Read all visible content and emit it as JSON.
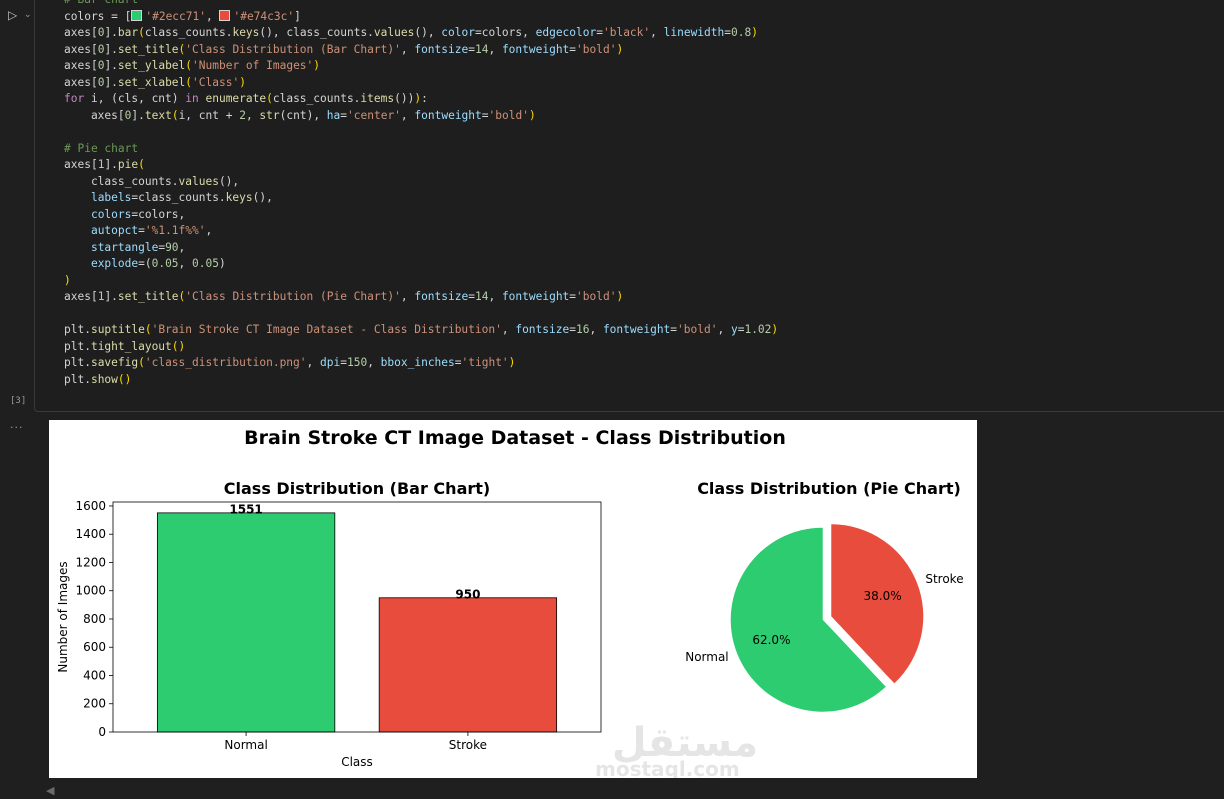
{
  "cell": {
    "execution_count": "[3]",
    "output_marker": "...",
    "code_lines": [
      [
        [
          "c-com",
          "# Bar chart"
        ]
      ],
      [
        [
          "",
          "colors = ["
        ],
        [
          "sw:#2ecc71",
          ""
        ],
        [
          "c-str",
          "'#2ecc71'"
        ],
        [
          "",
          ", "
        ],
        [
          "sw:#e74c3c",
          ""
        ],
        [
          "c-str",
          "'#e74c3c'"
        ],
        [
          "",
          "]"
        ]
      ],
      [
        [
          "",
          "axes["
        ],
        [
          "c-num",
          "0"
        ],
        [
          "",
          "]."
        ],
        [
          "c-fn",
          "bar"
        ],
        [
          "c-par",
          "("
        ],
        [
          "",
          "class_counts."
        ],
        [
          "c-fn",
          "keys"
        ],
        [
          "",
          "(), class_counts."
        ],
        [
          "c-fn",
          "values"
        ],
        [
          "",
          "(), "
        ],
        [
          "c-var",
          "color"
        ],
        [
          "",
          "=colors, "
        ],
        [
          "c-var",
          "edgecolor"
        ],
        [
          "",
          "="
        ],
        [
          "c-str",
          "'black'"
        ],
        [
          "",
          ", "
        ],
        [
          "c-var",
          "linewidth"
        ],
        [
          "",
          "="
        ],
        [
          "c-num",
          "0.8"
        ],
        [
          "c-par",
          ")"
        ]
      ],
      [
        [
          "",
          "axes["
        ],
        [
          "c-num",
          "0"
        ],
        [
          "",
          "]."
        ],
        [
          "c-fn",
          "set_title"
        ],
        [
          "c-par",
          "("
        ],
        [
          "c-str",
          "'Class Distribution (Bar Chart)'"
        ],
        [
          "",
          ", "
        ],
        [
          "c-var",
          "fontsize"
        ],
        [
          "",
          "="
        ],
        [
          "c-num",
          "14"
        ],
        [
          "",
          ", "
        ],
        [
          "c-var",
          "fontweight"
        ],
        [
          "",
          "="
        ],
        [
          "c-str",
          "'bold'"
        ],
        [
          "c-par",
          ")"
        ]
      ],
      [
        [
          "",
          "axes["
        ],
        [
          "c-num",
          "0"
        ],
        [
          "",
          "]."
        ],
        [
          "c-fn",
          "set_ylabel"
        ],
        [
          "c-par",
          "("
        ],
        [
          "c-str",
          "'Number of Images'"
        ],
        [
          "c-par",
          ")"
        ]
      ],
      [
        [
          "",
          "axes["
        ],
        [
          "c-num",
          "0"
        ],
        [
          "",
          "]."
        ],
        [
          "c-fn",
          "set_xlabel"
        ],
        [
          "c-par",
          "("
        ],
        [
          "c-str",
          "'Class'"
        ],
        [
          "c-par",
          ")"
        ]
      ],
      [
        [
          "c-kw",
          "for"
        ],
        [
          "",
          " i, (cls, cnt) "
        ],
        [
          "c-kw",
          "in"
        ],
        [
          "c-fn",
          " enumerate"
        ],
        [
          "c-par",
          "("
        ],
        [
          "",
          "class_counts."
        ],
        [
          "c-fn",
          "items"
        ],
        [
          "",
          "())"
        ],
        [
          "c-par",
          ")"
        ],
        [
          "",
          ":"
        ]
      ],
      [
        [
          "",
          "    axes["
        ],
        [
          "c-num",
          "0"
        ],
        [
          "",
          "]."
        ],
        [
          "c-fn",
          "text"
        ],
        [
          "c-par",
          "("
        ],
        [
          "",
          "i, cnt + "
        ],
        [
          "c-num",
          "2"
        ],
        [
          "",
          ", "
        ],
        [
          "c-fn",
          "str"
        ],
        [
          "",
          "(cnt), "
        ],
        [
          "c-var",
          "ha"
        ],
        [
          "",
          "="
        ],
        [
          "c-str",
          "'center'"
        ],
        [
          "",
          ", "
        ],
        [
          "c-var",
          "fontweight"
        ],
        [
          "",
          "="
        ],
        [
          "c-str",
          "'bold'"
        ],
        [
          "c-par",
          ")"
        ]
      ],
      [
        [
          "",
          ""
        ]
      ],
      [
        [
          "c-com",
          "# Pie chart"
        ]
      ],
      [
        [
          "",
          "axes["
        ],
        [
          "c-num",
          "1"
        ],
        [
          "",
          "]."
        ],
        [
          "c-fn",
          "pie"
        ],
        [
          "c-par",
          "("
        ]
      ],
      [
        [
          "",
          "    class_counts."
        ],
        [
          "c-fn",
          "values"
        ],
        [
          "",
          "(),"
        ]
      ],
      [
        [
          "",
          "    "
        ],
        [
          "c-var",
          "labels"
        ],
        [
          "",
          "=class_counts."
        ],
        [
          "c-fn",
          "keys"
        ],
        [
          "",
          "(),"
        ]
      ],
      [
        [
          "",
          "    "
        ],
        [
          "c-var",
          "colors"
        ],
        [
          "",
          "=colors,"
        ]
      ],
      [
        [
          "",
          "    "
        ],
        [
          "c-var",
          "autopct"
        ],
        [
          "",
          "="
        ],
        [
          "c-str",
          "'%1.1f%%'"
        ],
        [
          "",
          ","
        ]
      ],
      [
        [
          "",
          "    "
        ],
        [
          "c-var",
          "startangle"
        ],
        [
          "",
          "="
        ],
        [
          "c-num",
          "90"
        ],
        [
          "",
          ","
        ]
      ],
      [
        [
          "",
          "    "
        ],
        [
          "c-var",
          "explode"
        ],
        [
          "",
          "=("
        ],
        [
          "c-num",
          "0.05"
        ],
        [
          "",
          ", "
        ],
        [
          "c-num",
          "0.05"
        ],
        [
          "",
          ")"
        ]
      ],
      [
        [
          "c-par",
          ")"
        ]
      ],
      [
        [
          "",
          "axes["
        ],
        [
          "c-num",
          "1"
        ],
        [
          "",
          "]."
        ],
        [
          "c-fn",
          "set_title"
        ],
        [
          "c-par",
          "("
        ],
        [
          "c-str",
          "'Class Distribution (Pie Chart)'"
        ],
        [
          "",
          ", "
        ],
        [
          "c-var",
          "fontsize"
        ],
        [
          "",
          "="
        ],
        [
          "c-num",
          "14"
        ],
        [
          "",
          ", "
        ],
        [
          "c-var",
          "fontweight"
        ],
        [
          "",
          "="
        ],
        [
          "c-str",
          "'bold'"
        ],
        [
          "c-par",
          ")"
        ]
      ],
      [
        [
          "",
          ""
        ]
      ],
      [
        [
          "",
          "plt."
        ],
        [
          "c-fn",
          "suptitle"
        ],
        [
          "c-par",
          "("
        ],
        [
          "c-str",
          "'Brain Stroke CT Image Dataset - Class Distribution'"
        ],
        [
          "",
          ", "
        ],
        [
          "c-var",
          "fontsize"
        ],
        [
          "",
          "="
        ],
        [
          "c-num",
          "16"
        ],
        [
          "",
          ", "
        ],
        [
          "c-var",
          "fontweight"
        ],
        [
          "",
          "="
        ],
        [
          "c-str",
          "'bold'"
        ],
        [
          "",
          ", "
        ],
        [
          "c-var",
          "y"
        ],
        [
          "",
          "="
        ],
        [
          "c-num",
          "1.02"
        ],
        [
          "c-par",
          ")"
        ]
      ],
      [
        [
          "",
          "plt."
        ],
        [
          "c-fn",
          "tight_layout"
        ],
        [
          "c-par",
          "()"
        ]
      ],
      [
        [
          "",
          "plt."
        ],
        [
          "c-fn",
          "savefig"
        ],
        [
          "c-par",
          "("
        ],
        [
          "c-str",
          "'class_distribution.png'"
        ],
        [
          "",
          ", "
        ],
        [
          "c-var",
          "dpi"
        ],
        [
          "",
          "="
        ],
        [
          "c-num",
          "150"
        ],
        [
          "",
          ", "
        ],
        [
          "c-var",
          "bbox_inches"
        ],
        [
          "",
          "="
        ],
        [
          "c-str",
          "'tight'"
        ],
        [
          "c-par",
          ")"
        ]
      ],
      [
        [
          "",
          "plt."
        ],
        [
          "c-fn",
          "show"
        ],
        [
          "c-par",
          "()"
        ]
      ]
    ]
  },
  "figure": {
    "suptitle": "Brain Stroke CT Image Dataset - Class Distribution",
    "watermark": {
      "arabic": "مستقل",
      "latin": "mostaql.com"
    }
  },
  "chart_data": [
    {
      "type": "bar",
      "title": "Class Distribution (Bar Chart)",
      "xlabel": "Class",
      "ylabel": "Number of Images",
      "categories": [
        "Normal",
        "Stroke"
      ],
      "values": [
        1551,
        950
      ],
      "colors": [
        "#2ecc71",
        "#e74c3c"
      ],
      "ylim": [
        0,
        1628
      ],
      "yticks": [
        0,
        200,
        400,
        600,
        800,
        1000,
        1200,
        1400,
        1600
      ],
      "data_labels": [
        "1551",
        "950"
      ]
    },
    {
      "type": "pie",
      "title": "Class Distribution (Pie Chart)",
      "labels": [
        "Normal",
        "Stroke"
      ],
      "values": [
        1551,
        950
      ],
      "percent_labels": [
        "62.0%",
        "38.0%"
      ],
      "colors": [
        "#2ecc71",
        "#e74c3c"
      ],
      "startangle": 90,
      "explode": [
        0.05,
        0.05
      ]
    }
  ]
}
